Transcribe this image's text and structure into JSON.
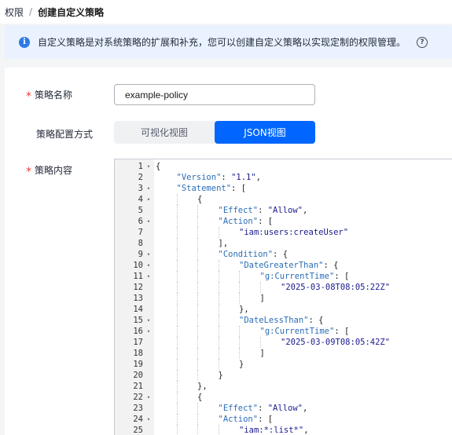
{
  "breadcrumb": {
    "parent": "权限",
    "separator": "/",
    "current": "创建自定义策略"
  },
  "info": {
    "icon": "info-icon",
    "text": "自定义策略是对系统策略的扩展和补充，您可以创建自定义策略以实现定制的权限管理。",
    "help_icon": "question-circle-icon"
  },
  "form": {
    "required_mark": "*",
    "name_label": "策略名称",
    "name_value": "example-policy",
    "mode_label": "策略配置方式",
    "mode_options": [
      "可视化视图",
      "JSON视图"
    ],
    "mode_selected": "JSON视图",
    "content_label": "策略内容"
  },
  "colors": {
    "primary": "#0066ff",
    "required": "#e2403f",
    "info_bg": "#e9f2fe",
    "json_key": "#2a6db6",
    "json_string": "#1a1a8c"
  },
  "editor": {
    "lines": [
      {
        "n": "1",
        "fold": true,
        "indent": 0,
        "segs": [
          [
            "p",
            "{"
          ]
        ]
      },
      {
        "n": "2",
        "fold": false,
        "indent": 1,
        "segs": [
          [
            "k",
            "\"Version\""
          ],
          [
            "p",
            ": "
          ],
          [
            "s",
            "\"1.1\""
          ],
          [
            "p",
            ","
          ]
        ]
      },
      {
        "n": "3",
        "fold": true,
        "indent": 1,
        "segs": [
          [
            "k",
            "\"Statement\""
          ],
          [
            "p",
            ": ["
          ]
        ]
      },
      {
        "n": "4",
        "fold": true,
        "indent": 2,
        "segs": [
          [
            "p",
            "{"
          ]
        ]
      },
      {
        "n": "5",
        "fold": false,
        "indent": 3,
        "segs": [
          [
            "k",
            "\"Effect\""
          ],
          [
            "p",
            ": "
          ],
          [
            "s",
            "\"Allow\""
          ],
          [
            "p",
            ","
          ]
        ]
      },
      {
        "n": "6",
        "fold": true,
        "indent": 3,
        "segs": [
          [
            "k",
            "\"Action\""
          ],
          [
            "p",
            ": ["
          ]
        ]
      },
      {
        "n": "7",
        "fold": false,
        "indent": 4,
        "segs": [
          [
            "s",
            "\"iam:users:createUser\""
          ]
        ]
      },
      {
        "n": "8",
        "fold": false,
        "indent": 3,
        "segs": [
          [
            "p",
            "],"
          ]
        ]
      },
      {
        "n": "9",
        "fold": true,
        "indent": 3,
        "segs": [
          [
            "k",
            "\"Condition\""
          ],
          [
            "p",
            ": {"
          ]
        ]
      },
      {
        "n": "10",
        "fold": true,
        "indent": 4,
        "segs": [
          [
            "k",
            "\"DateGreaterThan\""
          ],
          [
            "p",
            ": {"
          ]
        ]
      },
      {
        "n": "11",
        "fold": true,
        "indent": 5,
        "segs": [
          [
            "k",
            "\"g:CurrentTime\""
          ],
          [
            "p",
            ": ["
          ]
        ]
      },
      {
        "n": "12",
        "fold": false,
        "indent": 6,
        "segs": [
          [
            "s",
            "\"2025-03-08T08:05:22Z\""
          ]
        ]
      },
      {
        "n": "13",
        "fold": false,
        "indent": 5,
        "segs": [
          [
            "p",
            "]"
          ]
        ]
      },
      {
        "n": "14",
        "fold": false,
        "indent": 4,
        "segs": [
          [
            "p",
            "},"
          ]
        ]
      },
      {
        "n": "15",
        "fold": true,
        "indent": 4,
        "segs": [
          [
            "k",
            "\"DateLessThan\""
          ],
          [
            "p",
            ": {"
          ]
        ]
      },
      {
        "n": "16",
        "fold": true,
        "indent": 5,
        "segs": [
          [
            "k",
            "\"g:CurrentTime\""
          ],
          [
            "p",
            ": ["
          ]
        ]
      },
      {
        "n": "17",
        "fold": false,
        "indent": 6,
        "segs": [
          [
            "s",
            "\"2025-03-09T08:05:42Z\""
          ]
        ]
      },
      {
        "n": "18",
        "fold": false,
        "indent": 5,
        "segs": [
          [
            "p",
            "]"
          ]
        ]
      },
      {
        "n": "19",
        "fold": false,
        "indent": 4,
        "segs": [
          [
            "p",
            "}"
          ]
        ]
      },
      {
        "n": "20",
        "fold": false,
        "indent": 3,
        "segs": [
          [
            "p",
            "}"
          ]
        ]
      },
      {
        "n": "21",
        "fold": false,
        "indent": 2,
        "segs": [
          [
            "p",
            "},"
          ]
        ]
      },
      {
        "n": "22",
        "fold": true,
        "indent": 2,
        "segs": [
          [
            "p",
            "{"
          ]
        ]
      },
      {
        "n": "23",
        "fold": false,
        "indent": 3,
        "segs": [
          [
            "k",
            "\"Effect\""
          ],
          [
            "p",
            ": "
          ],
          [
            "s",
            "\"Allow\""
          ],
          [
            "p",
            ","
          ]
        ]
      },
      {
        "n": "24",
        "fold": true,
        "indent": 3,
        "segs": [
          [
            "k",
            "\"Action\""
          ],
          [
            "p",
            ": ["
          ]
        ]
      },
      {
        "n": "25",
        "fold": false,
        "indent": 4,
        "segs": [
          [
            "s",
            "\"iam:*:list*\""
          ],
          [
            "p",
            ","
          ]
        ]
      }
    ]
  }
}
